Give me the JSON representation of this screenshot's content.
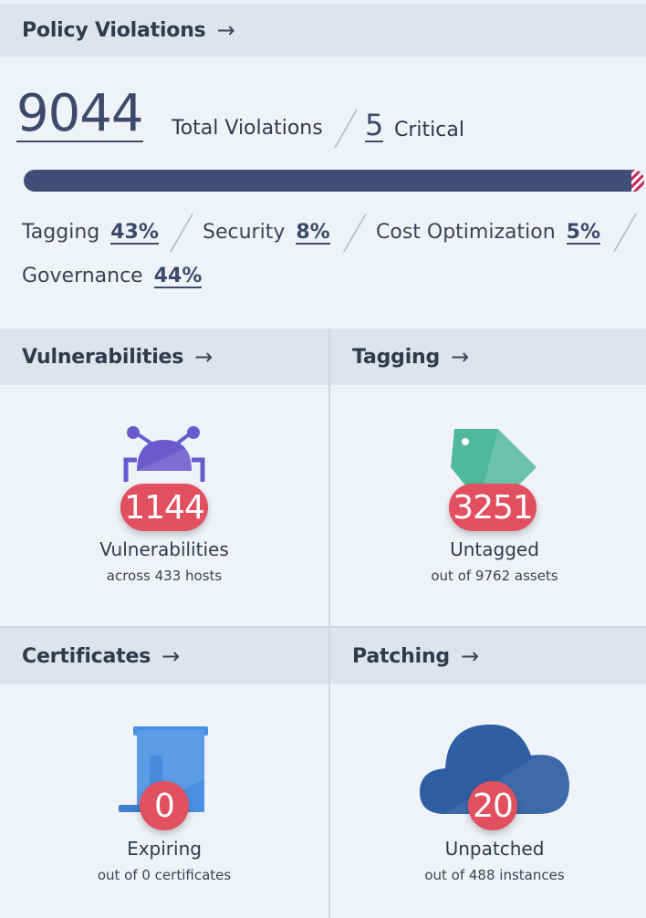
{
  "policy": {
    "title": "Policy Violations",
    "arrow": "→",
    "total": "9044",
    "total_label": "Total Violations",
    "critical": "5",
    "critical_label": "Critical",
    "progress_fraction": 0.9994,
    "categories": [
      {
        "name": "Tagging",
        "pct": "43%"
      },
      {
        "name": "Security",
        "pct": "8%"
      },
      {
        "name": "Cost Optimization",
        "pct": "5%"
      },
      {
        "name": "Governance",
        "pct": "44%"
      }
    ]
  },
  "tiles": {
    "vulnerabilities": {
      "title": "Vulnerabilities",
      "count": "1144",
      "label": "Vulnerabilities",
      "sub": "across 433 hosts",
      "icon": "bug-icon"
    },
    "tagging": {
      "title": "Tagging",
      "count": "3251",
      "label": "Untagged",
      "sub": "out of 9762 assets",
      "icon": "tag-icon"
    },
    "certificates": {
      "title": "Certificates",
      "count": "0",
      "label": "Expiring",
      "sub": "out of 0 certificates",
      "icon": "certificate-scroll-icon"
    },
    "patching": {
      "title": "Patching",
      "count": "20",
      "label": "Unpatched",
      "sub": "out of 488 instances",
      "icon": "cloud-icon"
    }
  },
  "colors": {
    "progress": "#3f4e76",
    "critical_stripe": "#c2315d",
    "badge": "#e24f5f",
    "bug": "#6a5acd",
    "tag": "#4fb99a",
    "certificate": "#4a90e2",
    "cloud": "#2e5ea3"
  }
}
